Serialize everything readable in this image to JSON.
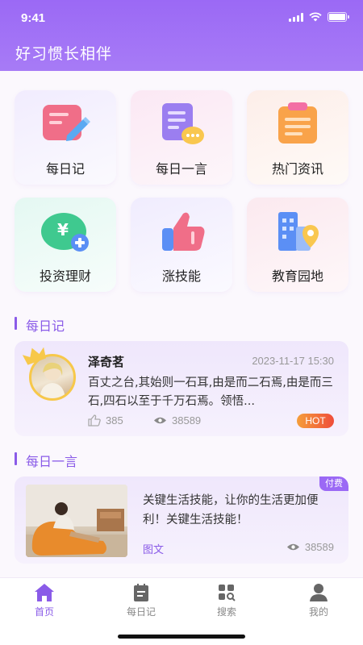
{
  "status_bar": {
    "time": "9:41"
  },
  "header": {
    "title": "好习惯长相伴"
  },
  "grid": [
    {
      "label": "每日记",
      "icon": "diary-pencil-icon"
    },
    {
      "label": "每日一言",
      "icon": "message-doc-icon"
    },
    {
      "label": "热门资讯",
      "icon": "clipboard-icon"
    },
    {
      "label": "投资理财",
      "icon": "yen-coin-plus-icon"
    },
    {
      "label": "涨技能",
      "icon": "thumbs-up-icon"
    },
    {
      "label": "教育园地",
      "icon": "building-location-icon"
    }
  ],
  "sections": {
    "diary": "每日记",
    "quote": "每日一言"
  },
  "diary_card": {
    "author": "泽奇茗",
    "date": "2023-11-17 15:30",
    "text": "百丈之台,其始则一石耳,由是而二石焉,由是而三石,四石以至于千万石焉。领悟...",
    "likes": "385",
    "views": "38589",
    "badge": "HOT"
  },
  "quote_card": {
    "badge": "付费",
    "text": "关键生活技能，让你的生活更加便利！关键生活技能！",
    "tag": "图文",
    "views": "38589"
  },
  "tabbar": [
    {
      "label": "首页",
      "icon": "home-icon",
      "active": true
    },
    {
      "label": "每日记",
      "icon": "diary-icon",
      "active": false
    },
    {
      "label": "搜索",
      "icon": "search-icon",
      "active": false
    },
    {
      "label": "我的",
      "icon": "profile-icon",
      "active": false
    }
  ],
  "colors": {
    "primary": "#9b69f5",
    "accent_text": "#8a5be8",
    "hot": "#ef4d3a"
  }
}
